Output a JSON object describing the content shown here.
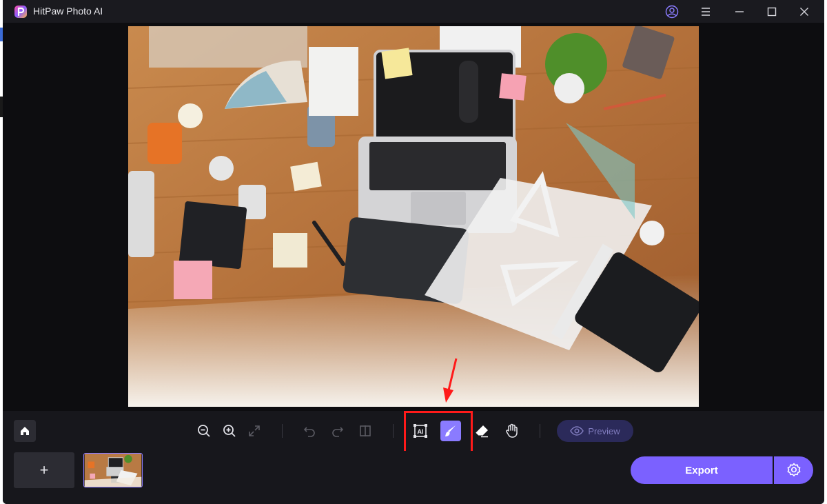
{
  "window": {
    "title": "HitPaw Photo AI"
  },
  "titlebar": {
    "icons": [
      "account-icon",
      "menu-icon",
      "minimize-icon",
      "maximize-icon",
      "close-icon"
    ]
  },
  "canvas": {
    "image": "office-desk-photo"
  },
  "toolbar": {
    "tools": [
      "home-icon",
      "zoom-out-icon",
      "zoom-in-icon",
      "fit-icon",
      "undo-icon",
      "redo-icon",
      "compare-icon",
      "ai-select-icon",
      "brush-icon",
      "eraser-icon",
      "hand-icon"
    ],
    "active_tool": "brush-icon",
    "preview_label": "Preview"
  },
  "bottom": {
    "add_label": "+",
    "export_label": "Export"
  },
  "colors": {
    "accent": "#7b61ff",
    "highlight": "#ff1a1a",
    "background": "#101014"
  }
}
